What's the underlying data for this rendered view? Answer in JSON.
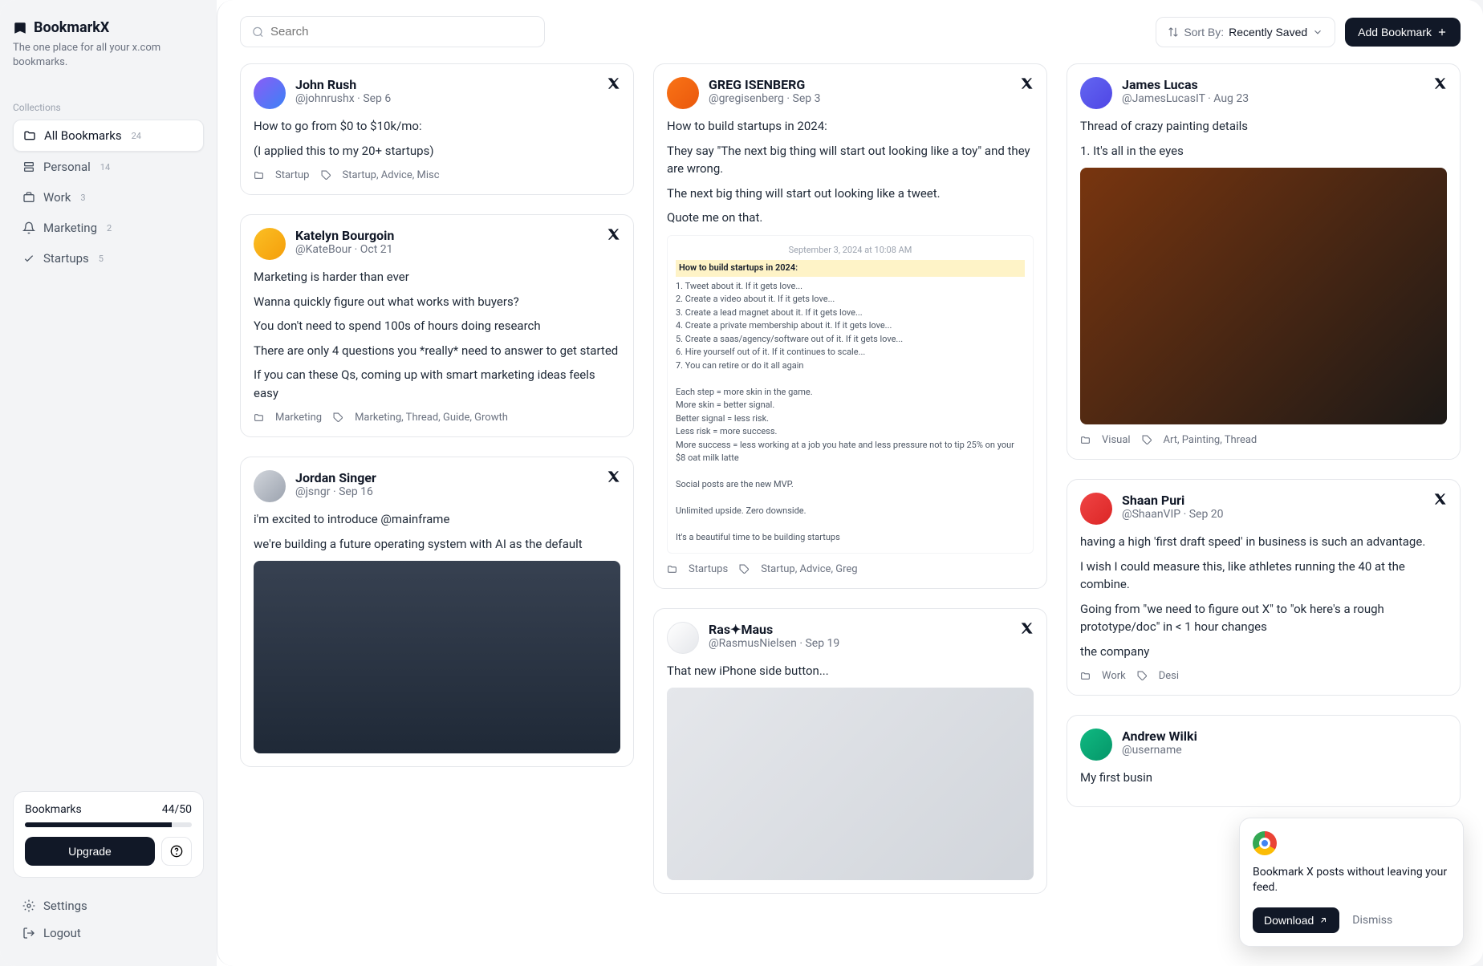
{
  "brand": {
    "name": "BookmarkX",
    "tagline": "The one place for all your x.com bookmarks."
  },
  "sidebar": {
    "collections_label": "Collections",
    "items": [
      {
        "label": "All Bookmarks",
        "count": "24"
      },
      {
        "label": "Personal",
        "count": "14"
      },
      {
        "label": "Work",
        "count": "3"
      },
      {
        "label": "Marketing",
        "count": "2"
      },
      {
        "label": "Startups",
        "count": "5"
      }
    ],
    "upgrade": {
      "label": "Bookmarks",
      "count": "44/50",
      "button": "Upgrade"
    },
    "settings": "Settings",
    "logout": "Logout"
  },
  "topbar": {
    "search_placeholder": "Search",
    "sort_label": "Sort By:",
    "sort_value": "Recently Saved",
    "add_button": "Add Bookmark"
  },
  "cards": [
    {
      "author": "John Rush",
      "handle": "@johnrushx",
      "date": "Sep 6",
      "lines": [
        "How to go from $0 to $10k/mo:",
        "(I applied this to my 20+ startups)"
      ],
      "folder": "Startup",
      "tags": "Startup, Advice, Misc"
    },
    {
      "author": "Katelyn Bourgoin",
      "handle": "@KateBour",
      "date": "Oct 21",
      "lines": [
        "Marketing is harder than ever",
        "Wanna quickly figure out what works with buyers?",
        "You don't need to spend 100s of hours doing research",
        "There are only 4 questions you *really* need to answer to get started",
        "If you can these Qs, coming up with smart marketing ideas feels easy"
      ],
      "folder": "Marketing",
      "tags": "Marketing, Thread, Guide, Growth"
    },
    {
      "author": "Jordan Singer",
      "handle": "@jsngr",
      "date": "Sep 16",
      "lines": [
        "i'm excited to introduce @mainframe",
        "we're building a future operating system with AI as the default"
      ],
      "has_image": true
    },
    {
      "author": "GREG ISENBERG",
      "handle": "@gregisenberg",
      "date": "Sep 3",
      "lines": [
        "How to build startups in 2024:",
        "They say \"The next big thing will start out looking like a toy\" and they are wrong.",
        "The next big thing will start out looking like a tweet.",
        "Quote me on that."
      ],
      "embed": {
        "timestamp": "September 3, 2024 at 10:08 AM",
        "heading": "How to build startups in 2024:",
        "steps": [
          "1. Tweet about it. If it gets love...",
          "2. Create a video about it. If it gets love...",
          "3. Create a lead magnet about it. If it gets love...",
          "4. Create a private membership about it. If it gets love...",
          "5. Create a saas/agency/software out of it. If it gets love...",
          "6. Hire yourself out of it. If it continues to scale...",
          "7. You can retire or do it all again"
        ],
        "notes": [
          "Each step = more skin in the game.",
          "More skin = better signal.",
          "Better signal = less risk.",
          "Less risk = more success.",
          "More success = less working at a job you hate and less pressure not to tip 25% on your $8 oat milk latte"
        ],
        "tail": [
          "Social posts are the new MVP.",
          "Unlimited upside. Zero downside.",
          "It's a beautiful time to be building startups"
        ]
      },
      "folder": "Startups",
      "tags": "Startup, Advice, Greg"
    },
    {
      "author": "Ras✦Maus",
      "handle": "@RasmusNielsen",
      "date": "Sep 19",
      "lines": [
        "That new iPhone side button..."
      ],
      "has_image": true
    },
    {
      "author": "James Lucas",
      "handle": "@JamesLucasIT",
      "date": "Aug 23",
      "lines": [
        "Thread of crazy painting details",
        "1. It's all in the eyes"
      ],
      "has_image": true,
      "folder": "Visual",
      "tags": "Art, Painting, Thread"
    },
    {
      "author": "Shaan Puri",
      "handle": "@ShaanVIP",
      "date": "Sep 20",
      "lines": [
        "having a high 'first draft speed' in business is such an advantage.",
        "I wish I could measure this, like athletes running the 40 at the combine.",
        "Going from \"we need to figure out X\" to \"ok here's a rough prototype/doc\" in < 1 hour changes",
        "the company"
      ],
      "folder": "Work",
      "tags": "Desi"
    },
    {
      "author": "Andrew Wilki",
      "handle": "@username",
      "date": "",
      "lines": [
        "My first busin"
      ]
    }
  ],
  "toast": {
    "message": "Bookmark X posts without leaving your feed.",
    "download": "Download",
    "dismiss": "Dismiss"
  }
}
